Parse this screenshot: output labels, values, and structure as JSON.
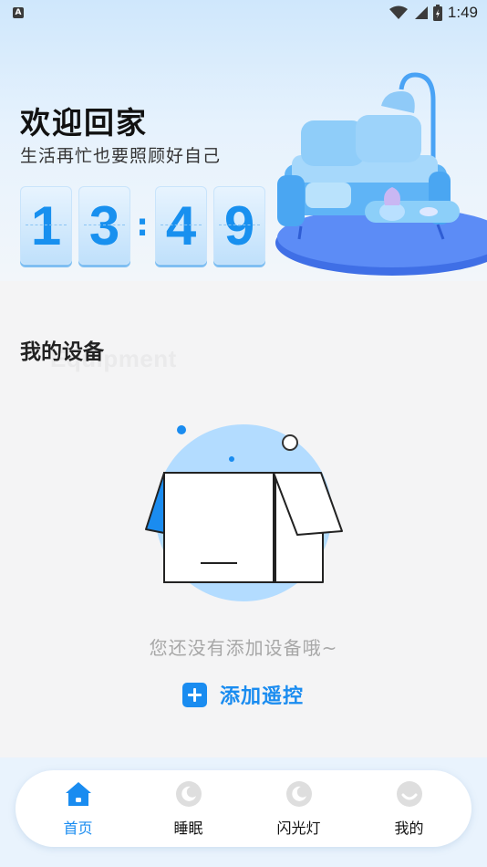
{
  "status_bar": {
    "time": "1:49"
  },
  "header": {
    "title": "欢迎回家",
    "subtitle": "生活再忙也要照顾好自己",
    "clock": {
      "d1": "1",
      "d2": "3",
      "sep": ":",
      "d3": "4",
      "d4": "9"
    }
  },
  "devices": {
    "title": "我的设备",
    "watermark": "Equipment",
    "empty_text": "您还没有添加设备哦~",
    "add_label": "添加遥控"
  },
  "tabs": [
    {
      "label": "首页",
      "icon": "home-icon",
      "active": true
    },
    {
      "label": "睡眠",
      "icon": "moon-icon",
      "active": false
    },
    {
      "label": "闪光灯",
      "icon": "moon-icon",
      "active": false
    },
    {
      "label": "我的",
      "icon": "smile-icon",
      "active": false
    }
  ],
  "colors": {
    "accent": "#1a8cf0",
    "inactive_icon": "#dcdcdc",
    "empty_text": "#a7a7a7"
  }
}
